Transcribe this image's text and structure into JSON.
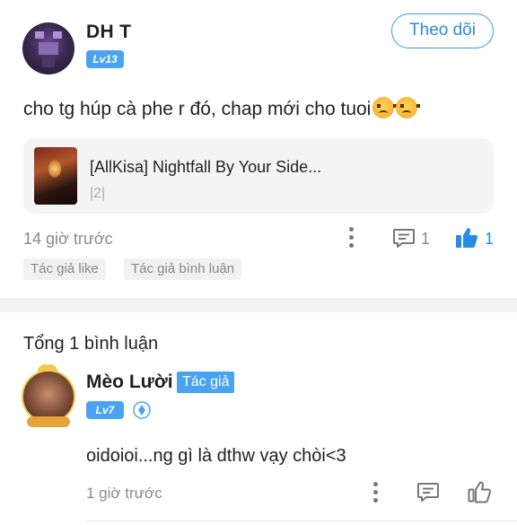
{
  "post": {
    "username": "DH T",
    "level": "Lv13",
    "follow_label": "Theo dõi",
    "text": "cho tg húp cà phe r đó, chap mới cho tuoi",
    "emojis": [
      "angry-face-icon",
      "angry-face-icon"
    ],
    "book": {
      "title": "[AllKisa] Nightfall By Your Side...",
      "chapter": "|2|"
    },
    "time": "14 giờ trước",
    "comment_count": "1",
    "like_count": "1",
    "tags": [
      "Tác giả like",
      "Tác giả bình luận"
    ]
  },
  "comments_section": {
    "total_label": "Tổng 1 bình luận"
  },
  "comment": {
    "username": "Mèo Lười",
    "author_badge": "Tác giả",
    "level": "Lv7",
    "text": "oidoioi...ng gì là dthw vạy chòi<3",
    "time": "1 giờ trước"
  },
  "colors": {
    "accent": "#3a98ee",
    "badge": "#4aa3f0",
    "muted_text": "#8a8a8a",
    "tag_bg": "#f1f1f1"
  }
}
